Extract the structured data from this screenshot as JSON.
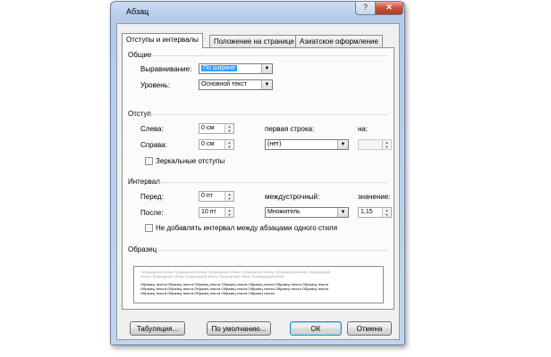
{
  "window": {
    "title": "Абзац",
    "help_label": "?",
    "close_label": "✕"
  },
  "tabs": [
    {
      "label": "Отступы и интервалы",
      "active": true
    },
    {
      "label": "Положение на странице",
      "active": false
    },
    {
      "label": "Азиатское оформление",
      "active": false
    }
  ],
  "general": {
    "section_title": "Общие",
    "alignment_label": "Выравнивание:",
    "alignment_value": "По ширине",
    "level_label": "Уровень:",
    "level_value": "Основной текст"
  },
  "indent": {
    "section_title": "Отступ",
    "left_label": "Слева:",
    "left_value": "0 см",
    "right_label": "Справа:",
    "right_value": "0 см",
    "first_line_label": "первая строка:",
    "first_line_value": "(нет)",
    "by_label": "на:",
    "by_value": "",
    "mirror_label": "Зеркальные отступы",
    "mirror_checked": false
  },
  "spacing": {
    "section_title": "Интервал",
    "before_label": "Перед:",
    "before_value": "0 пт",
    "after_label": "После:",
    "after_value": "10 пт",
    "line_spacing_label": "междустрочный:",
    "line_spacing_value": "Множитель",
    "value_label": "значение:",
    "value_value": "1,15",
    "no_space_label": "Не добавлять интервал между абзацами одного стиля",
    "no_space_checked": false
  },
  "preview": {
    "section_title": "Образец",
    "prev_paragraph": "Предыдущий абзац Предыдущий абзац Предыдущий абзац Предыдущий абзац Предыдущий абзац Предыдущий абзац Предыдущий абзац Предыдущий абзац Предыдущий абзац Предыдущий абзац",
    "sample_text": "Образец текста Образец текста Образец текста Образец текста Образец текста Образец текста Образец текста Образец текста Образец текста Образец текста Образец текста Образец текста Образец текста Образец текста Образец текста Образец текста Образец текста Образец текста Образец текста"
  },
  "buttons": {
    "tabs": "Табуляция...",
    "default": "По умолчанию...",
    "ok": "ОК",
    "cancel": "Отмена"
  },
  "colors": {
    "selection": "#3399ff",
    "default_button_border": "#3c7fb1"
  }
}
